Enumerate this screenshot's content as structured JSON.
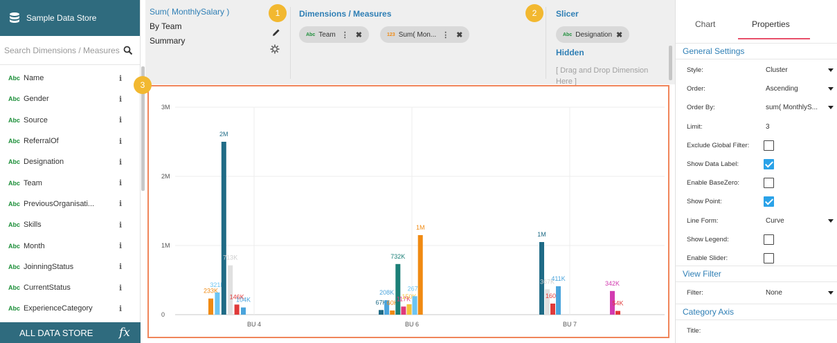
{
  "sidebar": {
    "store_title": "Sample Data Store",
    "search_placeholder": "Search Dimensions / Measures",
    "fields": [
      {
        "type": "Abc",
        "name": "Name"
      },
      {
        "type": "Abc",
        "name": "Gender"
      },
      {
        "type": "Abc",
        "name": "Source"
      },
      {
        "type": "Abc",
        "name": "ReferralOf"
      },
      {
        "type": "Abc",
        "name": "Designation"
      },
      {
        "type": "Abc",
        "name": "Team"
      },
      {
        "type": "Abc",
        "name": "PreviousOrganisati..."
      },
      {
        "type": "Abc",
        "name": "Skills"
      },
      {
        "type": "Abc",
        "name": "Month"
      },
      {
        "type": "Abc",
        "name": "JoinningStatus"
      },
      {
        "type": "Abc",
        "name": "CurrentStatus"
      },
      {
        "type": "Abc",
        "name": "ExperienceCategory"
      }
    ],
    "info_glyph": "i",
    "all_store_label": "ALL DATA STORE",
    "fx_glyph": "fx"
  },
  "shelf": {
    "measure_title": "Sum( MonthlySalary )",
    "by_line": "By Team",
    "summary_line": "Summary",
    "dm_title": "Dimensions / Measures",
    "pills": [
      {
        "icon": "Abc",
        "label": "Team"
      },
      {
        "icon": "123",
        "label": "Sum( Mon..."
      }
    ],
    "slicer_title": "Slicer",
    "slicer_pill": {
      "icon": "Abc",
      "label": "Designation"
    },
    "hidden_title": "Hidden",
    "drag_hint": "[ Drag and Drop Dimension Here ]",
    "kebab_glyph": "⋮",
    "close_glyph": "✖"
  },
  "badges": [
    "1",
    "2",
    "3"
  ],
  "chart_data": {
    "type": "bar",
    "categories": [
      "BU 4",
      "BU 6",
      "BU 7"
    ],
    "y_ticks": [
      "0",
      "1M",
      "2M",
      "3M"
    ],
    "ylim": [
      0,
      3000000
    ],
    "grid": true,
    "bars": {
      "BU 4": [
        {
          "value": 233000,
          "label": "233K",
          "color": "#f08a12"
        },
        {
          "value": 321000,
          "label": "321K",
          "color": "#6cc4f2"
        },
        {
          "value": 2500000,
          "label": "2M",
          "color": "#1f6b86"
        },
        {
          "value": 713000,
          "label": "713K",
          "color": "#e0e0e0"
        },
        {
          "value": 146000,
          "label": "146K",
          "color": "#e03a3a"
        },
        {
          "value": 104000,
          "label": "104K",
          "color": "#4aa4dc"
        }
      ],
      "BU 6": [
        {
          "value": 67000,
          "label": "67K",
          "color": "#1f6b86"
        },
        {
          "value": 208000,
          "label": "208K",
          "color": "#4aa4dc"
        },
        {
          "value": 60000,
          "label": "60K",
          "color": "#f08a12"
        },
        {
          "value": 732000,
          "label": "732K",
          "color": "#1b7f77"
        },
        {
          "value": 117000,
          "label": "117K",
          "color": "#e03a7a"
        },
        {
          "value": 150000,
          "label": "150K",
          "color": "#f5c33b"
        },
        {
          "value": 267000,
          "label": "267K",
          "color": "#6cc4f2"
        },
        {
          "value": 1150000,
          "label": "1M",
          "color": "#f08a12"
        }
      ],
      "BU 7": [
        {
          "value": 1050000,
          "label": "1M",
          "color": "#1f6b86"
        },
        {
          "value": 367000,
          "label": "367K",
          "color": "#e0e0e0"
        },
        {
          "value": 160000,
          "label": "160K",
          "color": "#e03a3a"
        },
        {
          "value": 411000,
          "label": "411K",
          "color": "#4aa4dc"
        },
        {
          "value": 342000,
          "label": "342K",
          "color": "#d23bb0"
        },
        {
          "value": 54000,
          "label": "54K",
          "color": "#e03a3a"
        }
      ]
    }
  },
  "properties": {
    "tabs": [
      "Chart",
      "Properties"
    ],
    "general_title": "General Settings",
    "rows": [
      {
        "label": "Style:",
        "kind": "select",
        "value": "Cluster"
      },
      {
        "label": "Order:",
        "kind": "select",
        "value": "Ascending"
      },
      {
        "label": "Order By:",
        "kind": "select",
        "value": "sum( MonthlyS..."
      },
      {
        "label": "Limit:",
        "kind": "text",
        "value": "3"
      },
      {
        "label": "Exclude Global Filter:",
        "kind": "check",
        "checked": false
      },
      {
        "label": "Show Data Label:",
        "kind": "check",
        "checked": true
      },
      {
        "label": "Enable BaseZero:",
        "kind": "check",
        "checked": false
      },
      {
        "label": "Show Point:",
        "kind": "check",
        "checked": true
      },
      {
        "label": "Line Form:",
        "kind": "select",
        "value": "Curve"
      },
      {
        "label": "Show Legend:",
        "kind": "check",
        "checked": false
      },
      {
        "label": "Enable Slider:",
        "kind": "check",
        "checked": false
      }
    ],
    "view_filter_title": "View Filter",
    "filter_label": "Filter:",
    "filter_value": "None",
    "category_axis_title": "Category Axis",
    "title_label": "Title:"
  },
  "colors": {
    "brand": "#2f6b7e",
    "link": "#2f7fb5",
    "badge": "#f2b830",
    "chart_border": "#f0855a",
    "tab_underline": "#e84f6a",
    "checkbox_on": "#2aa2e8"
  }
}
